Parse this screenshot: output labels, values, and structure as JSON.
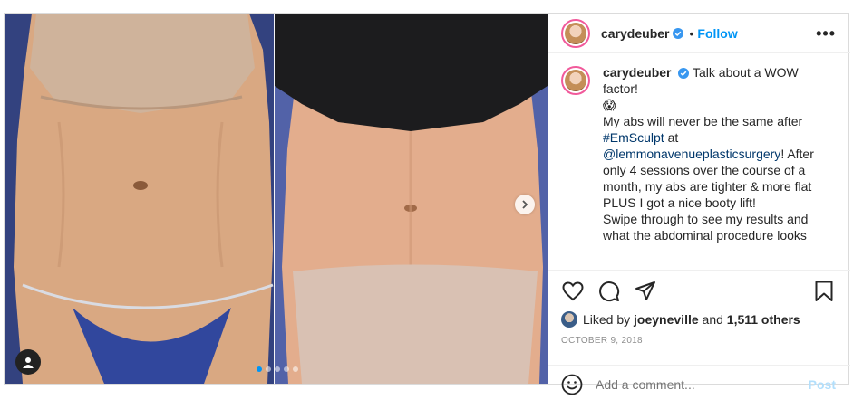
{
  "post": {
    "username": "carydeuber",
    "follow_label": "Follow",
    "separator": "•",
    "more_label": "•••",
    "caption": {
      "username": "carydeuber",
      "line1": "Talk about a WOW factor!",
      "emoji": "😱",
      "line2": "My abs will never be the same after ",
      "hashtag": "#EmSculpt",
      "line3": " at ",
      "mention": "@lemmonavenueplasticsurgery",
      "line4": "! After only 4 sessions over the course of a month, my abs are tighter & more flat PLUS I got a nice booty lift!",
      "line5": "Swipe through to see my results and what the abdominal procedure looks"
    },
    "likes": {
      "prefix": "Liked by ",
      "user": "joeyneville",
      "middle": " and ",
      "count": "1,511 others"
    },
    "date": "OCTOBER 9, 2018",
    "comment_placeholder": "Add a comment...",
    "post_label": "Post",
    "carousel": {
      "total": 5,
      "current": 1
    }
  },
  "colors": {
    "accent": "#0095f6",
    "link": "#00376b",
    "muted": "#8e8e8e",
    "post_disabled": "#b2dffc"
  },
  "icons": {
    "verified": "verified-badge-icon",
    "like": "heart-icon",
    "comment": "comment-bubble-icon",
    "share": "paper-plane-icon",
    "save": "bookmark-icon",
    "emoji": "smiley-icon",
    "next": "chevron-right-icon",
    "tag": "user-tag-icon"
  }
}
